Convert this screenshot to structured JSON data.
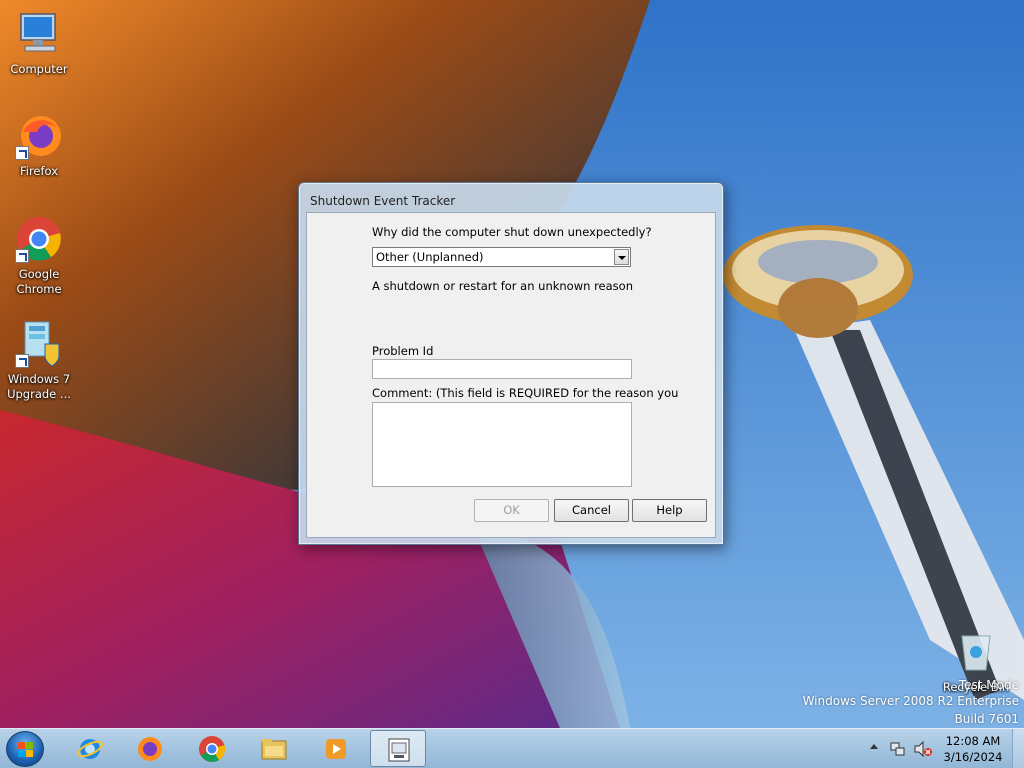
{
  "desktop": {
    "icons": [
      {
        "label": "Computer"
      },
      {
        "label": "Firefox"
      },
      {
        "label": "Google Chrome"
      },
      {
        "label": "Windows 7 Upgrade ..."
      },
      {
        "label": "Recycle Bin"
      }
    ]
  },
  "dialog": {
    "title": "Shutdown Event Tracker",
    "question": "Why did the computer shut down unexpectedly?",
    "reason_selected": "Other (Unplanned)",
    "reason_description": "A shutdown or restart for an unknown reason",
    "problem_id_label": "Problem Id",
    "problem_id_value": "",
    "comment_label": "Comment: (This field is REQUIRED for the reason you selected)",
    "comment_value": "",
    "buttons": {
      "ok": "OK",
      "cancel": "Cancel",
      "help": "Help"
    }
  },
  "watermark": {
    "line1": "Test Mode",
    "line2": "Windows Server 2008 R2 Enterprise",
    "line3": "Build 7601"
  },
  "taskbar": {
    "pinned": [
      "internet-explorer",
      "firefox",
      "chrome",
      "file-explorer",
      "media-player",
      "shutdown-tracker"
    ],
    "clock_time": "12:08 AM",
    "clock_date": "3/16/2024"
  },
  "colors": {
    "sky": "#3b83d4",
    "dialog_frame": "#c8daeb",
    "taskbar": "#a8c6e0"
  }
}
